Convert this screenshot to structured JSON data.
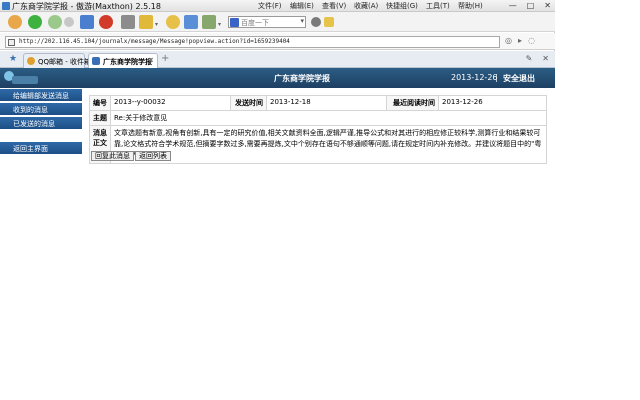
{
  "window": {
    "title": "广东商学院学报 - 傲游(Maxthon) 2.5.18",
    "controls": [
      "—",
      "□",
      "✕"
    ]
  },
  "menubar": [
    "文件(F)",
    "编辑(E)",
    "查看(V)",
    "收藏(A)",
    "快捷组(G)",
    "工具(T)",
    "帮助(H)"
  ],
  "toolbar": {
    "search_placeholder": "百度一下"
  },
  "address": {
    "url": "http://202.116.45.104/journalx/message/Message!popview.action?id=1659239404"
  },
  "tabs": [
    {
      "label": "QQ邮箱 - 收件箱",
      "active": false
    },
    {
      "label": "广东商学院学报",
      "active": true
    }
  ],
  "site": {
    "title": "广东商学院学报",
    "date": "2013-12-26",
    "separator": "|",
    "logout": "安全退出"
  },
  "sidebar": {
    "items": [
      "给编辑部发送消息",
      "收到的消息",
      "已发送的消息",
      "返回主界面"
    ]
  },
  "message": {
    "labels": {
      "id": "编号",
      "send_time": "发送时间",
      "read_time": "最近阅读时间",
      "subject": "主题",
      "body": "消息"
    },
    "id": "2013--y-00032",
    "send_time": "2013-12-18",
    "read_time": "2013-12-26",
    "subject": "Re:关于修改意见",
    "body": "文章选题有新意,视角有创新,具有一定的研究价值,相关文献资料全面,逻辑严谨,推导公式和对其进行的相应修正较科学,测算行业和结果较可靠,论文格式符合学术规范,但摘要字数过多,需要再提炼,文中个别存在语句不够通顺等问题,请在规定时间内补充修改。并建议将题目中的\"粤省\"改为\"广东\"。",
    "body_prefix": "正文",
    "reply_button": "回复此消息",
    "back_button": "返回列表"
  },
  "colors": {
    "header": "#1d3f63",
    "sidebar": "#2f6aa8"
  }
}
